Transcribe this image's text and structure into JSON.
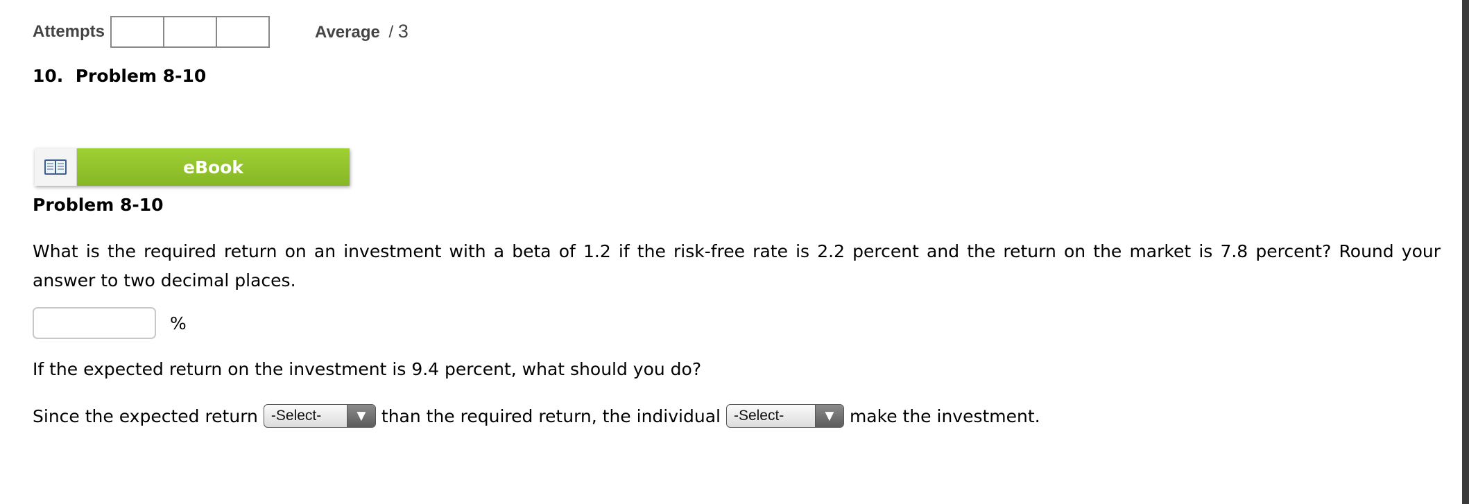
{
  "header": {
    "attempts_label": "Attempts",
    "average_label": "Average",
    "average_separator": "/",
    "average_total": "3"
  },
  "question": {
    "title": "10.  Problem 8-10",
    "ebook_label": "eBook",
    "heading": "Problem 8-10",
    "text": "What is the required return on an investment with a beta of 1.2 if the risk-free rate is 2.2 percent and the return on the market is 7.8 percent? Round your answer to two decimal places.",
    "answer_value": "",
    "answer_unit": "%",
    "followup": "If the expected return on the investment is 9.4 percent, what should you do?",
    "sentence": {
      "part1": "Since the expected return",
      "select1": "-Select-",
      "part2": "than the required return, the individual",
      "select2": "-Select-",
      "part3": "make the investment."
    }
  },
  "colors": {
    "ebook_green": "#8dc12b",
    "text": "#000000",
    "muted_text": "#444444"
  },
  "icons": {
    "ebook": "open-book-icon",
    "dropdown": "triangle-down-icon"
  }
}
